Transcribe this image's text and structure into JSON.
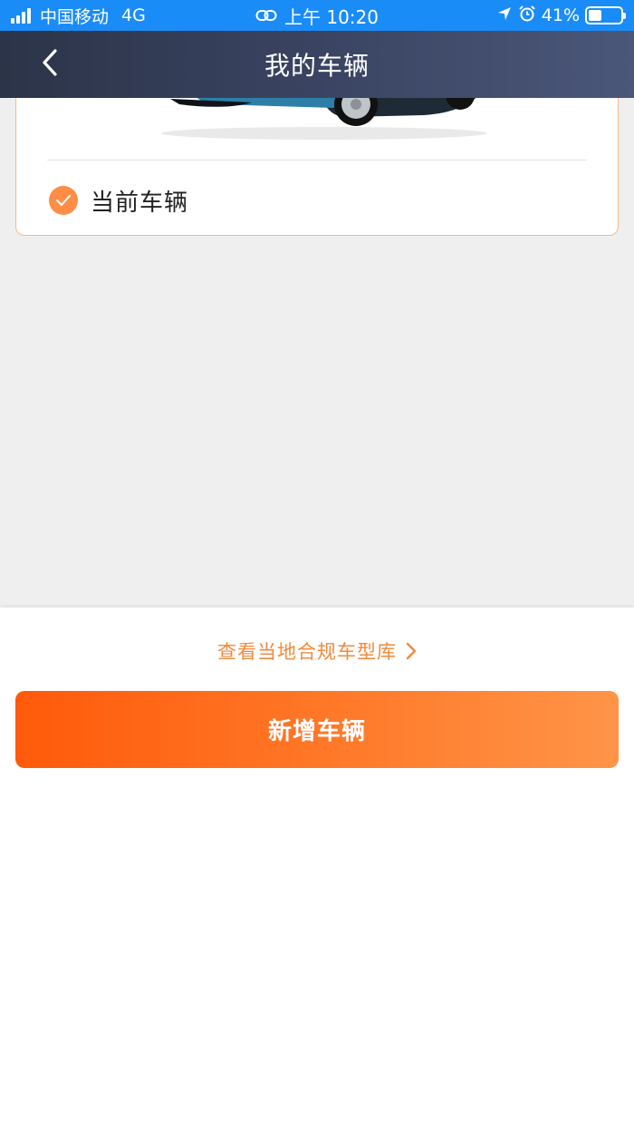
{
  "status_bar": {
    "carrier": "中国移动",
    "network": "4G",
    "time": "上午 10:20",
    "battery_percent": "41%",
    "battery_level": 0.41,
    "icons": [
      "signal-icon",
      "link-icon",
      "location-arrow-icon",
      "alarm-icon",
      "battery-icon"
    ]
  },
  "nav": {
    "title": "我的车辆",
    "back_icon": "chevron-left-icon"
  },
  "vehicle_card": {
    "current_label": "当前车辆",
    "check_icon": "check-circle-icon",
    "selected": true
  },
  "bottom": {
    "compliance_link": "查看当地合规车型库",
    "chevron_icon": "chevron-right-icon",
    "add_button": "新增车辆"
  },
  "colors": {
    "status_bar": "#1a8cf7",
    "nav_start": "#2c3448",
    "nav_end": "#4b5779",
    "accent": "#ff8d45",
    "link": "#f08a3e",
    "button_start": "#ff5a0a",
    "button_end": "#ff9448",
    "background": "#efefef"
  }
}
